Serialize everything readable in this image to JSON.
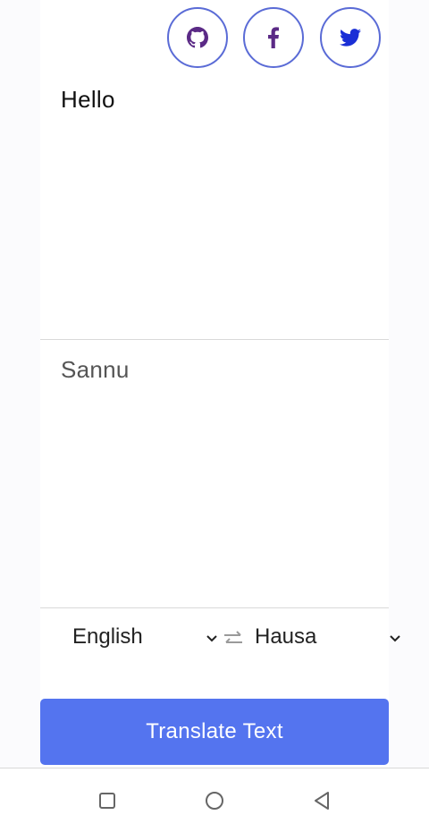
{
  "social": {
    "github_icon": "github-icon",
    "facebook_icon": "facebook-icon",
    "twitter_icon": "twitter-icon",
    "border_color": "#5a6bd6"
  },
  "translator": {
    "source_text": "Hello",
    "translated_text": "Sannu",
    "source_language": "English",
    "target_language": "Hausa",
    "swap_icon": "swap-arrows-icon",
    "translate_button_label": "Translate Text",
    "accent_color": "#5474ef"
  },
  "system_nav": {
    "recents_icon": "square-icon",
    "home_icon": "circle-icon",
    "back_icon": "triangle-back-icon"
  }
}
